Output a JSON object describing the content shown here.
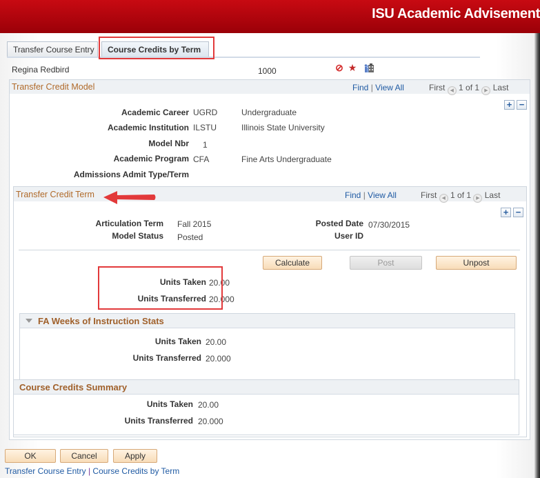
{
  "banner": {
    "title": "ISU Academic Advisement"
  },
  "tabs": [
    {
      "label": "Transfer Course Entry",
      "active": false
    },
    {
      "label": "Course Credits by Term",
      "active": true
    }
  ],
  "student": {
    "name": "Regina Redbird",
    "id": "1000",
    "icons": [
      "no-access-icon",
      "star-icon",
      "building-people-icon"
    ]
  },
  "model": {
    "title": "Transfer Credit Model",
    "nav": {
      "find": "Find",
      "sep": "|",
      "view_all": "View All",
      "first": "First",
      "count": "1 of 1",
      "last": "Last"
    },
    "fields": [
      {
        "label": "Academic Career",
        "code": "UGRD",
        "desc": "Undergraduate"
      },
      {
        "label": "Academic Institution",
        "code": "ILSTU",
        "desc": "Illinois State University"
      },
      {
        "label": "Model Nbr",
        "code": "1",
        "desc": ""
      },
      {
        "label": "Academic Program",
        "code": "CFA",
        "desc": "Fine Arts Undergraduate"
      },
      {
        "label": "Admissions Admit Type/Term",
        "code": "",
        "desc": ""
      }
    ]
  },
  "term": {
    "title": "Transfer Credit Term",
    "nav": {
      "find": "Find",
      "sep": "|",
      "view_all": "View All",
      "first": "First",
      "count": "1 of 1",
      "last": "Last"
    },
    "articulation_term_label": "Articulation Term",
    "articulation_term": "Fall 2015",
    "model_status_label": "Model Status",
    "model_status": "Posted",
    "posted_date_label": "Posted Date",
    "posted_date": "07/30/2015",
    "user_id_label": "User ID",
    "user_id": "",
    "buttons": {
      "calculate": "Calculate",
      "post": "Post",
      "unpost": "Unpost"
    },
    "units_taken_label": "Units Taken",
    "units_taken": "20.00",
    "units_transferred_label": "Units Transferred",
    "units_transferred": "20.000"
  },
  "fa_weeks": {
    "title": "FA Weeks of Instruction Stats",
    "units_taken_label": "Units Taken",
    "units_taken": "20.00",
    "units_transferred_label": "Units Transferred",
    "units_transferred": "20.000"
  },
  "summary": {
    "title": "Course Credits Summary",
    "units_taken_label": "Units Taken",
    "units_taken": "20.00",
    "units_transferred_label": "Units Transferred",
    "units_transferred": "20.000"
  },
  "actions": {
    "ok": "OK",
    "cancel": "Cancel",
    "apply": "Apply"
  },
  "footer_links": {
    "link1": "Transfer Course Entry",
    "sep": "|",
    "link2": "Course Credits by Term"
  },
  "colors": {
    "banner": "#c80a12",
    "group_title": "#b06a2a",
    "link": "#1f5aa3",
    "annotation": "#e2393a"
  }
}
